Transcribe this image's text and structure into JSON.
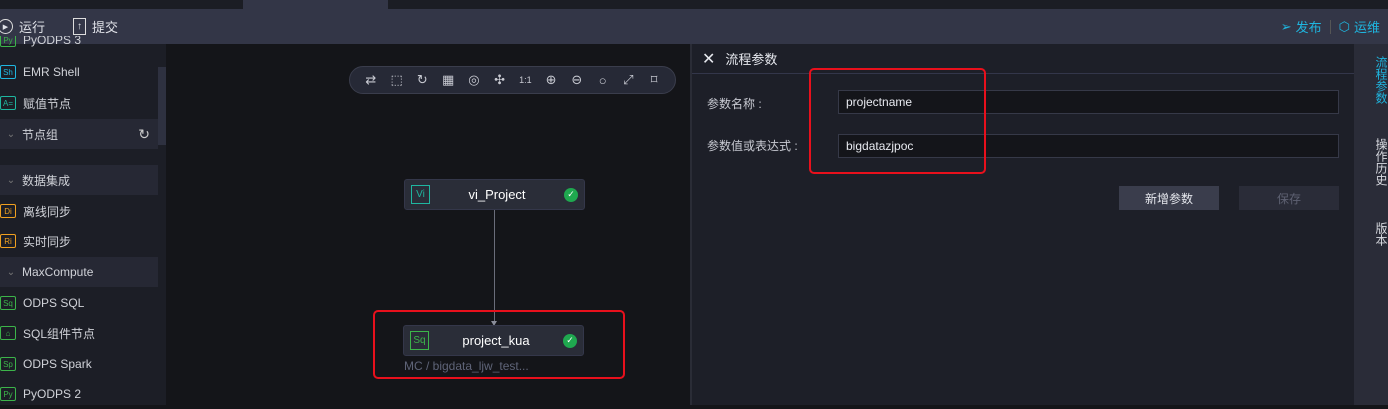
{
  "toolbar": {
    "run": "运行",
    "submit": "提交",
    "publish": "发布",
    "ops": "运维"
  },
  "sidebar": {
    "items": [
      {
        "icon": "Sh",
        "label": "EMR Shell",
        "color": "#1fb6e0"
      },
      {
        "icon": "A=",
        "label": "赋值节点",
        "color": "#1fb6a0"
      },
      {
        "group": true,
        "label": "节点组"
      },
      {
        "group": true,
        "label": "数据集成"
      },
      {
        "icon": "Di",
        "label": "离线同步",
        "color": "#f0a020"
      },
      {
        "icon": "Ri",
        "label": "实时同步",
        "color": "#f0a020"
      },
      {
        "group": true,
        "label": "MaxCompute"
      },
      {
        "icon": "Sq",
        "label": "ODPS SQL",
        "color": "#3cb44a"
      },
      {
        "icon": "⌂",
        "label": "SQL组件节点",
        "color": "#3cb44a"
      },
      {
        "icon": "Sp",
        "label": "ODPS Spark",
        "color": "#3cb44a"
      },
      {
        "icon": "Py",
        "label": "PyODPS 2",
        "color": "#3cb44a"
      }
    ],
    "partial_top": "PyODPS 3"
  },
  "canvas": {
    "tools": [
      "swap-icon",
      "select-icon",
      "refresh-icon",
      "grid-icon",
      "center-icon",
      "shrink-icon",
      "actual-size-icon",
      "zoom-in-icon",
      "zoom-out-icon",
      "search-icon",
      "fullscreen-icon",
      "tag-icon"
    ],
    "tool_glyphs": [
      "⇄",
      "⬚",
      "↻",
      "▦",
      "◎",
      "✣",
      "1:1",
      "⊕",
      "⊖",
      "○",
      "⤢",
      "⌑"
    ],
    "nodes": [
      {
        "icon": "Vi",
        "name": "vi_Project",
        "color": "#1fb6a0"
      },
      {
        "icon": "Sq",
        "name": "project_kua",
        "color": "#3cb44a",
        "sub": "MC / bigdata_ljw_test..."
      }
    ]
  },
  "panel": {
    "title": "流程参数",
    "name_label": "参数名称 :",
    "name_value": "projectname",
    "value_label": "参数值或表达式 :",
    "value_value": "bigdatazjpoc",
    "add_button": "新增参数",
    "save_button": "保存"
  },
  "rail": {
    "tabs": [
      "流程参数",
      "操作历史",
      "版本"
    ]
  },
  "colors": {
    "accent": "#1fb6e0",
    "highlight": "#e8101c",
    "success": "#1fa84f"
  }
}
